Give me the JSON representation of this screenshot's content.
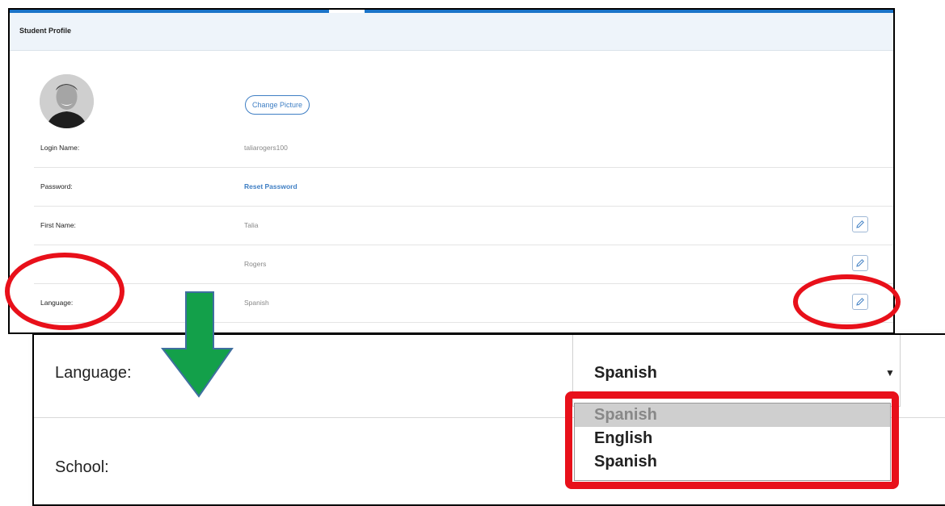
{
  "profile": {
    "header_title": "Student Profile",
    "change_picture_label": "Change Picture",
    "avatar_icon": "person-photo",
    "rows": [
      {
        "label": "Login Name:",
        "value": "taliarogers100",
        "editable": false,
        "is_link": false
      },
      {
        "label": "Password:",
        "value": "Reset Password",
        "editable": false,
        "is_link": true
      },
      {
        "label": "First Name:",
        "value": "Talia",
        "editable": true,
        "is_link": false
      },
      {
        "label": "",
        "value": "Rogers",
        "editable": true,
        "is_link": false
      },
      {
        "label": "Language:",
        "value": "Spanish",
        "editable": true,
        "is_link": false
      }
    ],
    "edit_icon": "pencil-icon"
  },
  "zoom": {
    "language_label": "Language:",
    "school_label": "School:",
    "select_value": "Spanish",
    "caret": "▼",
    "options": [
      {
        "label": "Spanish",
        "selected": true
      },
      {
        "label": "English",
        "selected": false
      },
      {
        "label": "Spanish",
        "selected": false
      }
    ]
  },
  "annotations": {
    "highlight_color": "#e8101a",
    "arrow_color": "#13a04a",
    "accent_color": "#1a73c8"
  }
}
